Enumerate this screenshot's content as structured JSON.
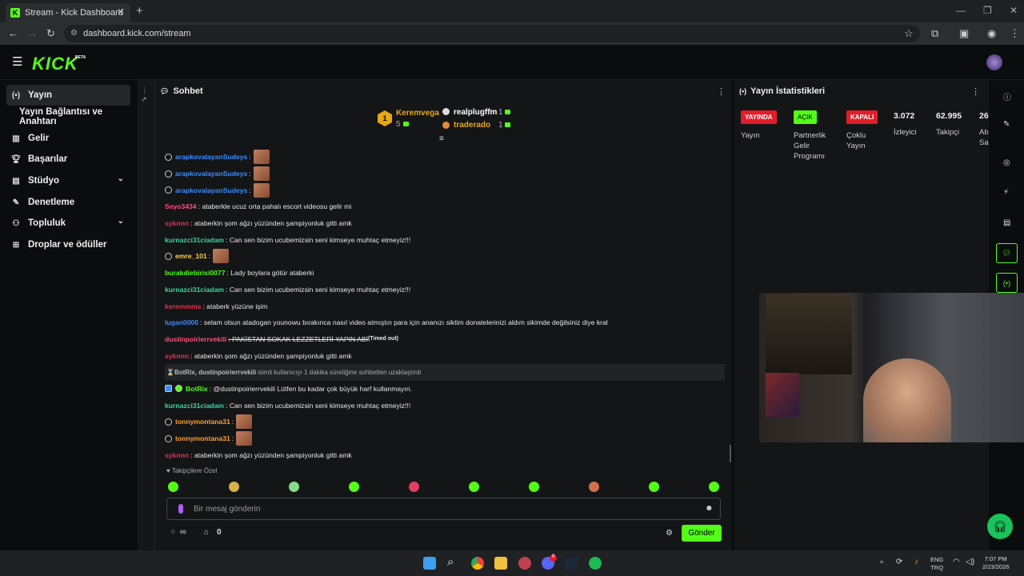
{
  "browser": {
    "tab_title": "Stream - Kick Dashboard",
    "url": "dashboard.kick.com/stream"
  },
  "brand": {
    "logo": "KICK",
    "beta": "BETA",
    "accent": "#53fc18"
  },
  "sidebar": {
    "items": [
      {
        "label": "Yayın",
        "icon": "broadcast-icon",
        "active": true
      },
      {
        "label": "Yayın Bağlantısı ve Anahtarı",
        "icon": "",
        "sub": true
      },
      {
        "label": "Gelir",
        "icon": "chart-icon"
      },
      {
        "label": "Başarılar",
        "icon": "trophy-icon"
      },
      {
        "label": "Stüdyo",
        "icon": "studio-icon",
        "expand": true
      },
      {
        "label": "Denetleme",
        "icon": "wrench-icon"
      },
      {
        "label": "Topluluk",
        "icon": "community-icon",
        "expand": true
      },
      {
        "label": "Droplar ve ödüller",
        "icon": "gift-icon"
      }
    ]
  },
  "chat": {
    "title": "Sohbet",
    "leaderboard": [
      {
        "rank": "1",
        "name": "Keremvega",
        "count": "5"
      },
      {
        "name": "realplugffm",
        "count": "1"
      },
      {
        "name": "traderado",
        "count": "1"
      }
    ],
    "messages": [
      {
        "user": "arapkovalayanSudeys",
        "color": "#3b8cff",
        "text": ":",
        "emote": true,
        "badge": true
      },
      {
        "user": "arapkovalayanSudeys",
        "color": "#3b8cff",
        "text": ":",
        "emote": true,
        "badge": true
      },
      {
        "user": "arapkovalayanSudeys",
        "color": "#3b8cff",
        "text": ":",
        "emote": true,
        "badge": true
      },
      {
        "user": "Seyo3434",
        "color": "#ff4f7b",
        "text": ": ataberkle ucuz orta pahalı escort videosu gelir mi"
      },
      {
        "user": "syknnn",
        "color": "#e8314c",
        "text": ": ataberkin şom ağzı yüzünden şampiyonluk gitti amk"
      },
      {
        "user": "kurnazci31ciadam",
        "color": "#3ad6a0",
        "text": ": Can sen bizim ucubemizsin seni kimseye muhtaç etmeyiz!!!"
      },
      {
        "user": "emre_101",
        "color": "#ffcf4a",
        "text": ":",
        "emote": true,
        "badge": true
      },
      {
        "user": "burakdiebirisi0077",
        "color": "#53fc18",
        "text": ": Lady boylara götür ataberki"
      },
      {
        "user": "kurnazci31ciadam",
        "color": "#3ad6a0",
        "text": ": Can sen bizim ucubemizsin seni kimseye muhtaç etmeyiz!!!"
      },
      {
        "user": "keremmms",
        "color": "#e8314c",
        "text": ": ataberk yüzüne işim"
      },
      {
        "user": "lugan0000",
        "color": "#3b8cff",
        "text": ": selam olsun atadogan younowu bırakınca nasıl video atmıştın para için ananızı siktim donatelerinizi aldım sikimde değilsiniz diye kral"
      },
      {
        "user": "dustinpoirierrvekili",
        "color": "#ff4f7b",
        "text": ": PAKİSTAN SOKAK LEZZETLERİ YAPIN ABİ",
        "suffix": "(Timed out)",
        "strike": true
      },
      {
        "user": "syknnn",
        "color": "#e8314c",
        "text": ": ataberkin şom ağzı yüzünden şampiyonluk gitti amk"
      },
      {
        "system": true,
        "user": "BotRix, dustinpoirierrvekili",
        "text": "isimli kullanıcıyı 1 dakika süreliğine sohbetten uzaklaştırdı"
      },
      {
        "user": "BotRix",
        "color": "#53fc18",
        "text": ": @dustinpoirierrvekili Lütfen bu kadar çok büyük harf kullanmayın.",
        "bot": true
      },
      {
        "user": "kurnazci31ciadam",
        "color": "#3ad6a0",
        "text": ": Can sen bizim ucubemizsin seni kimseye muhtaç etmeyiz!!!"
      },
      {
        "user": "tonnymontana31",
        "color": "#ff9f2f",
        "text": ":",
        "emote": true,
        "badge": true
      },
      {
        "user": "tonnymontana31",
        "color": "#ff9f2f",
        "text": ":",
        "emote": true,
        "badge": true
      },
      {
        "user": "syknnn",
        "color": "#e8314c",
        "text": ": ataberkin şom ağzı yüzünden şampiyonluk gitti amk"
      }
    ],
    "followers_only": "Takipçilere Özel",
    "input_placeholder": "Bir mesaj gönderin",
    "points": "∞",
    "store_count": "0",
    "send_label": "Gönder"
  },
  "stats": {
    "title": "Yayın İstatistikleri",
    "pills": [
      {
        "text": "YAYINDA",
        "label": "Yayın",
        "bg": "#e11d2a"
      },
      {
        "text": "AÇIK",
        "label": "Partnerlik Gelir Programı",
        "bg": "#53fc18"
      },
      {
        "text": "KAPALI",
        "label": "Çoklu Yayın",
        "bg": "#e11d2a"
      }
    ],
    "numbers": [
      {
        "value": "3.072",
        "label": "İzleyici"
      },
      {
        "value": "62.995",
        "label": "Takipçi"
      },
      {
        "value": "26",
        "label": "Ab Sa"
      }
    ]
  },
  "taskbar": {
    "lang": "ENG",
    "lang2": "TRQ",
    "time": "7:07 PM",
    "date": "2/23/2026",
    "discord_badge": "9"
  }
}
